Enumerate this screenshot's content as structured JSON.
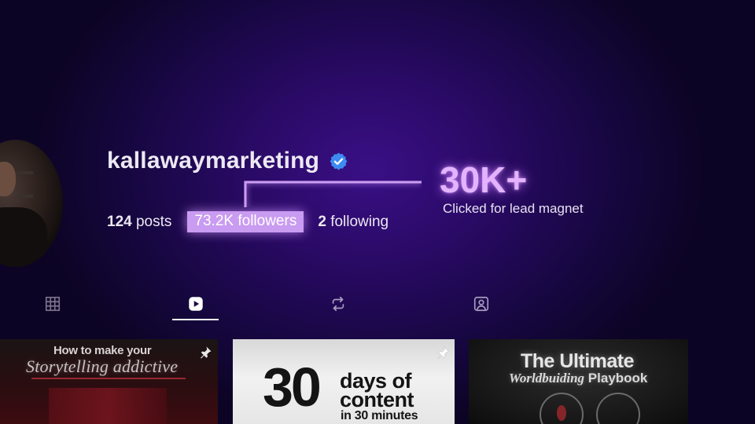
{
  "profile": {
    "username": "kallawaymarketing",
    "verified_icon": "verified-badge-icon",
    "verified_color": "#3d8bf2",
    "stats": {
      "posts_count": "124",
      "posts_label": "posts",
      "followers_count": "73.2K",
      "followers_label": "followers",
      "following_count": "2",
      "following_label": "following"
    }
  },
  "callout": {
    "value": "30K+",
    "caption": "Clicked for lead magnet",
    "accent_color": "#c99bf1"
  },
  "tabs": [
    {
      "icon": "grid-icon",
      "active": false
    },
    {
      "icon": "reels-icon",
      "active": true
    },
    {
      "icon": "reposts-icon",
      "active": false
    },
    {
      "icon": "tagged-icon",
      "active": false
    }
  ],
  "posts": [
    {
      "line1": "How to make your",
      "line2": "Storytelling addictive",
      "pinned": true
    },
    {
      "big": "30",
      "line1": "days of",
      "line2": "content",
      "line3": "in 30 minutes",
      "pinned": true
    },
    {
      "line1": "The Ultimate",
      "line2a": "Worldbuiding",
      "line2b": "Playbook",
      "pinned": false
    }
  ]
}
